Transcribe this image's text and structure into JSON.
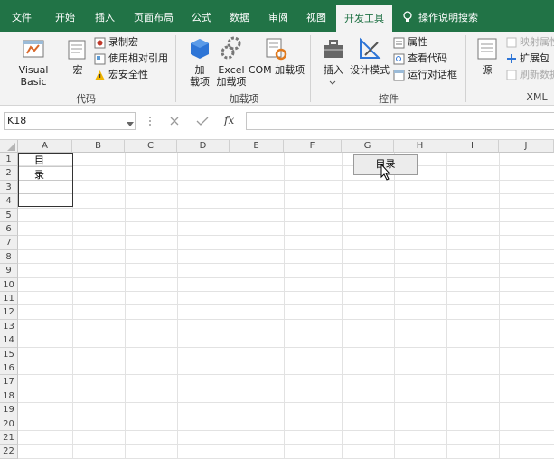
{
  "tabs": [
    "文件",
    "开始",
    "插入",
    "页面布局",
    "公式",
    "数据",
    "审阅",
    "视图",
    "开发工具"
  ],
  "tell_me": "操作说明搜索",
  "ribbon": {
    "code_group": "代码",
    "visual_basic": "Visual Basic",
    "macro": "宏",
    "record_macro": "录制宏",
    "relative_ref": "使用相对引用",
    "macro_security": "宏安全性",
    "addins_group": "加载项",
    "addins": "加\n载项",
    "excel_addins": "Excel\n加载项",
    "com_addins": "COM 加载项",
    "controls_group": "控件",
    "insert": "插入",
    "design_mode": "设计模式",
    "properties": "属性",
    "view_code": "查看代码",
    "run_dialog": "运行对话框",
    "xml_group": "XML",
    "source": "源",
    "map_properties": "映射属性",
    "expansion_packs": "扩展包",
    "refresh_data": "刷新数据"
  },
  "formula_bar": {
    "name_box": "K18",
    "fx": "fx",
    "value": ""
  },
  "columns": [
    "A",
    "B",
    "C",
    "D",
    "E",
    "F",
    "G",
    "H",
    "I",
    "J"
  ],
  "rows": [
    "1",
    "2",
    "3",
    "4",
    "5",
    "6",
    "7",
    "8",
    "9",
    "10",
    "11",
    "12",
    "13",
    "14",
    "15",
    "16",
    "17",
    "18",
    "19",
    "20",
    "21",
    "22"
  ],
  "cells": {
    "A1": "目录"
  },
  "button_shape": "目录",
  "colors": {
    "accent": "#217346"
  }
}
